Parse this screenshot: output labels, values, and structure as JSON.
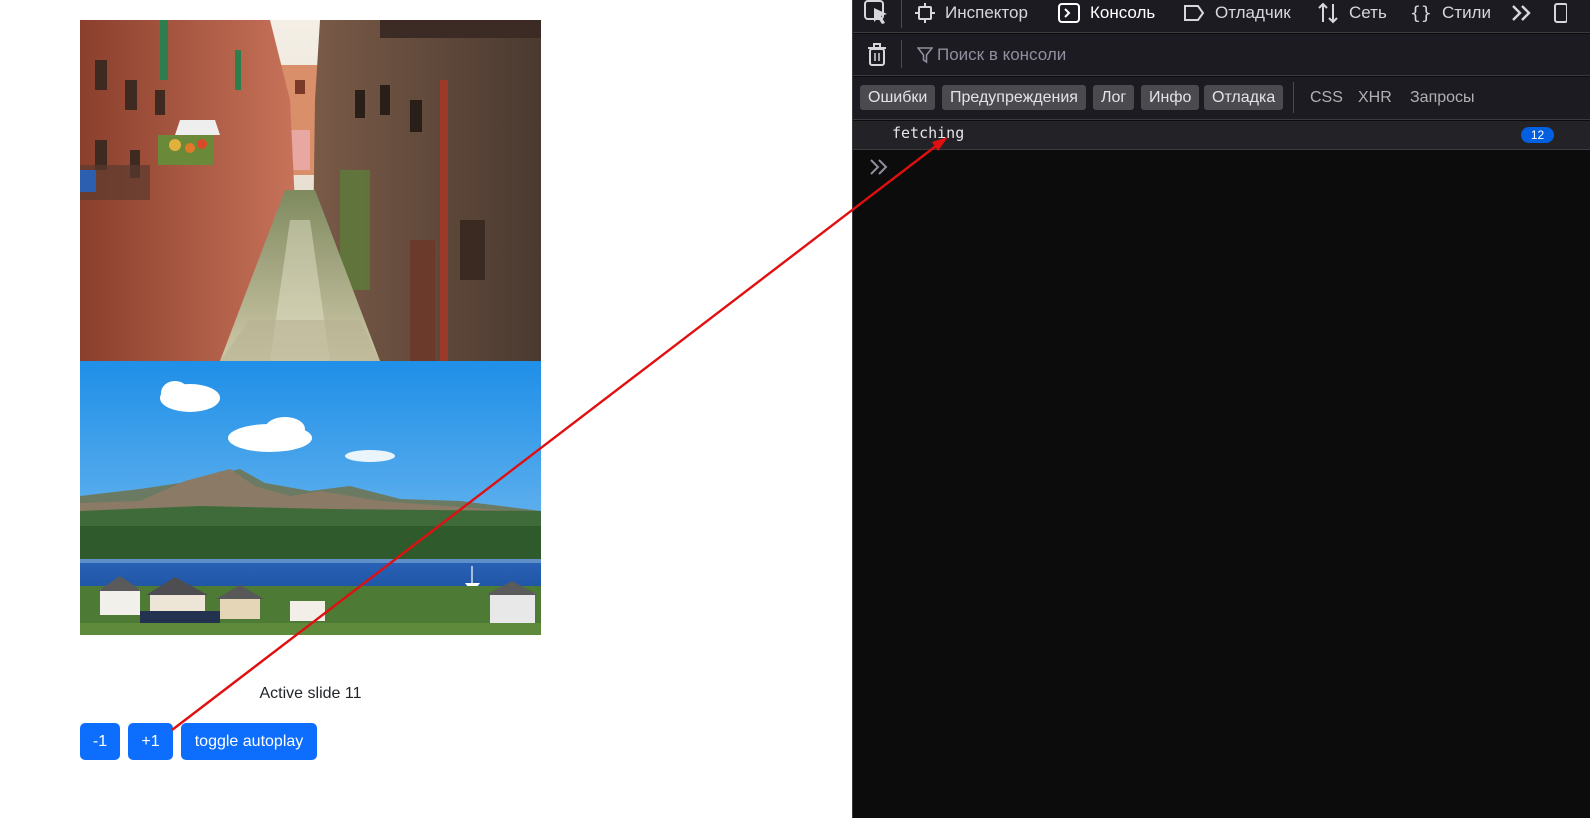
{
  "page": {
    "status_text": "Active slide 11",
    "buttons": {
      "prev_label": "-1",
      "next_label": "+1",
      "toggle_label": "toggle autoplay"
    },
    "slides": [
      {
        "name": "canal-photo"
      },
      {
        "name": "lake-photo"
      }
    ],
    "accent_color": "#0d6efd"
  },
  "devtools": {
    "tabs": [
      {
        "icon": "inspector-icon",
        "label": "Инспектор"
      },
      {
        "icon": "console-icon",
        "label": "Консоль",
        "active": true
      },
      {
        "icon": "debugger-icon",
        "label": "Отладчик"
      },
      {
        "icon": "network-icon",
        "label": "Сеть"
      },
      {
        "icon": "styles-icon",
        "label": "Стили"
      }
    ],
    "search_placeholder": "Поиск в консоли",
    "levels": [
      "Ошибки",
      "Предупреждения",
      "Лог",
      "Инфо",
      "Отладка"
    ],
    "requests": [
      "CSS",
      "XHR",
      "Запросы"
    ],
    "log": {
      "message": "fetching",
      "count": "12"
    },
    "badge_color": "#0060df",
    "annotation_arrow_color": "#e01010"
  }
}
